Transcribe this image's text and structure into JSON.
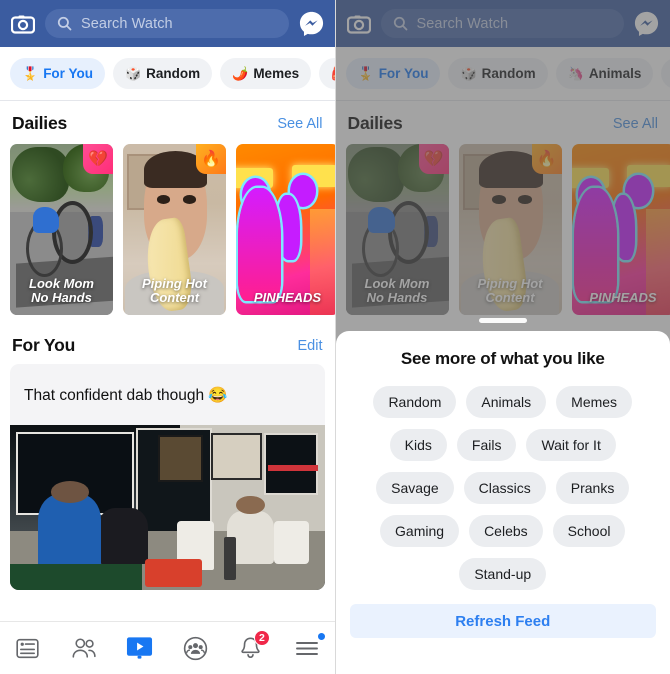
{
  "header": {
    "camera_icon": "camera-icon",
    "search_placeholder": "Search Watch",
    "search_value": "",
    "search_icon": "search-icon",
    "messenger_icon": "messenger-icon",
    "background_color": "#3b5ca0"
  },
  "chips": {
    "left": [
      {
        "label": "For You",
        "emoji": "🎖️",
        "active": true
      },
      {
        "label": "Random",
        "emoji": "🎲",
        "active": false
      },
      {
        "label": "Memes",
        "emoji": "🌶️",
        "active": false
      },
      {
        "label": "",
        "emoji": "🎒",
        "active": false
      }
    ],
    "right": [
      {
        "label": "For You",
        "emoji": "🎖️",
        "active": true
      },
      {
        "label": "Random",
        "emoji": "🎲",
        "active": false
      },
      {
        "label": "Animals",
        "emoji": "🦄",
        "active": false
      },
      {
        "label": "",
        "emoji": "🌶️",
        "active": false
      }
    ]
  },
  "dailies": {
    "title": "Dailies",
    "see_all": "See All",
    "cards": [
      {
        "caption": "Look Mom\nNo Hands",
        "badge": "💔",
        "badge_style": "pink"
      },
      {
        "caption": "Piping Hot\nContent",
        "badge": "🔥",
        "badge_style": "orange"
      },
      {
        "caption": "PINHEADS",
        "badge": "",
        "badge_style": "none"
      }
    ]
  },
  "for_you": {
    "title": "For You",
    "edit": "Edit",
    "post_text": "That confident dab though 😂"
  },
  "tabbar": {
    "items": [
      {
        "name": "news-feed-tab",
        "icon": "news-feed-icon",
        "badge": "",
        "dot": false
      },
      {
        "name": "friends-tab",
        "icon": "friends-icon",
        "badge": "",
        "dot": false
      },
      {
        "name": "watch-tab",
        "icon": "watch-video-icon",
        "badge": "",
        "dot": false,
        "active": true
      },
      {
        "name": "groups-tab",
        "icon": "groups-icon",
        "badge": "",
        "dot": false
      },
      {
        "name": "notifications-tab",
        "icon": "bell-icon",
        "badge": "2",
        "dot": false
      },
      {
        "name": "menu-tab",
        "icon": "hamburger-menu-icon",
        "badge": "",
        "dot": true
      }
    ]
  },
  "sheet": {
    "title": "See more of what you like",
    "rows": [
      [
        "Random",
        "Animals",
        "Memes"
      ],
      [
        "Kids",
        "Fails",
        "Wait for It"
      ],
      [
        "Savage",
        "Classics",
        "Pranks"
      ],
      [
        "Gaming",
        "Celebs",
        "School"
      ],
      [
        "Stand-up"
      ]
    ],
    "refresh_label": "Refresh Feed",
    "refresh_color": "#2d7ff0"
  }
}
